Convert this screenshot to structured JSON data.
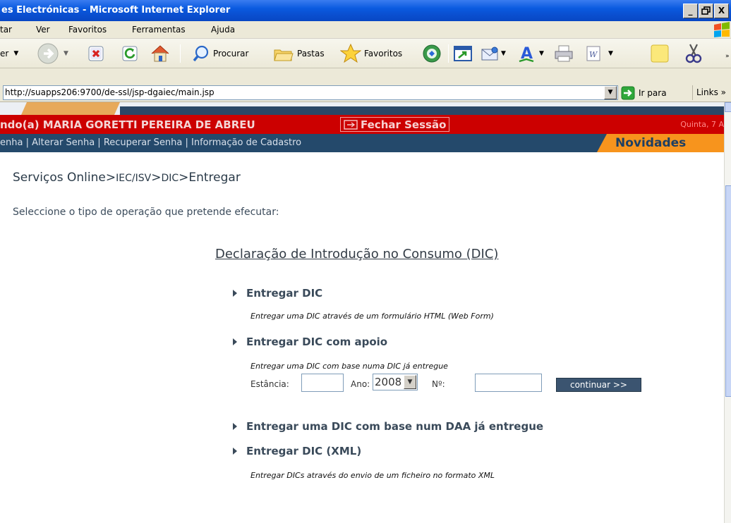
{
  "window": {
    "title": "es Electrónicas - Microsoft Internet Explorer",
    "controls": [
      "_",
      "̅",
      "X"
    ]
  },
  "menubar": {
    "items": [
      "tar",
      "Ver",
      "Favoritos",
      "Ferramentas",
      "Ajuda"
    ]
  },
  "toolbar": {
    "back_label": "er",
    "search_label": "Procurar",
    "folders_label": "Pastas",
    "favorites_label": "Favoritos"
  },
  "addressbar": {
    "url": "http://suapps206:9700/de-ssl/jsp-dgaiec/main.jsp",
    "go_label": "Ir para",
    "links_label": "Links"
  },
  "site": {
    "user_greeting": "ndo(a) MARIA GORETTI PEREIRA DE ABREU",
    "logout_label": "Fechar Sessão",
    "date_text": "Quinta, 7 A",
    "nav_links": "enha  |  Alterar Senha  |  Recuperar Senha  |  Informação de Cadastro",
    "news_label": "Novidades"
  },
  "content": {
    "breadcrumb": {
      "part1": "Serviços Online",
      "sep1": ">",
      "part2": "IEC/ISV",
      "sep2": ">",
      "part3": "DIC",
      "sep3": ">",
      "part4": "Entregar"
    },
    "instruction": "Seleccione o tipo de operação que pretende efecutar:",
    "section_title": "Declaração de Introdução no Consumo (DIC)",
    "options": [
      {
        "label": "Entregar DIC",
        "description": "Entregar uma DIC através de um formulário HTML (Web Form)"
      },
      {
        "label": "Entregar DIC com apoio",
        "description": "Entregar uma DIC com base numa DIC já entregue"
      },
      {
        "label": "Entregar uma DIC com base num DAA já entregue",
        "description": ""
      },
      {
        "label": "Entregar DIC (XML)",
        "description": "Entregar DICs através do envio de um ficheiro no formato XML"
      }
    ],
    "form": {
      "estancia_label": "Estância:",
      "estancia_value": "",
      "ano_label": "Ano:",
      "ano_value": "2008",
      "numero_label": "Nº:",
      "numero_value": "",
      "continue_label": "continuar >>"
    }
  },
  "colors": {
    "title_bar": "#0a5ae0",
    "red_bar": "#cc0000",
    "nav_bar": "#24496b",
    "news_tab": "#f7941d",
    "continue_button": "#3b5470"
  }
}
